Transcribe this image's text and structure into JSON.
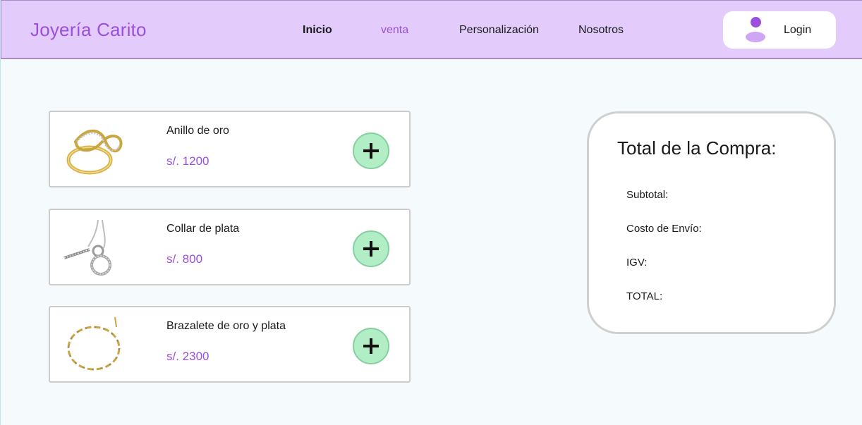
{
  "header": {
    "brand": "Joyería Carito",
    "nav": [
      "Inicio",
      "venta",
      "Personalización",
      "Nosotros"
    ],
    "login_label": "Login",
    "accent_color": "#9a4fdd",
    "background_color": "#e3ccfc"
  },
  "products": [
    {
      "name": "Anillo de oro",
      "price": "s/. 1200",
      "image": "gold-ring"
    },
    {
      "name": "Collar de plata",
      "price": "s/. 800",
      "image": "silver-necklace"
    },
    {
      "name": "Brazalete de oro y plata",
      "price": "s/. 2300",
      "image": "gold-silver-bracelet"
    }
  ],
  "add_button_icon": "plus-icon",
  "summary": {
    "title": "Total de la Compra:",
    "lines": [
      "Subtotal:",
      "Costo de Envío:",
      "IGV:",
      "TOTAL:"
    ]
  }
}
